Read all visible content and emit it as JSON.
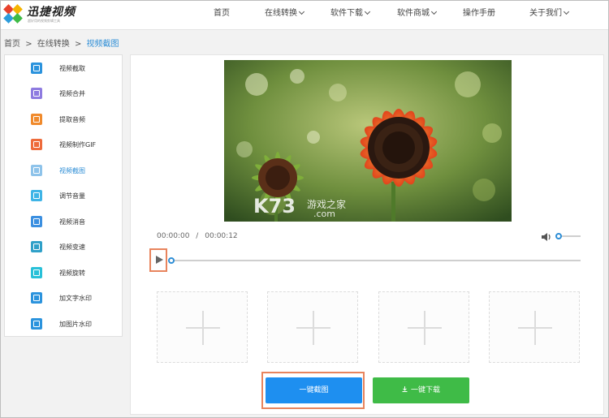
{
  "header": {
    "logo_title": "迅捷视频",
    "logo_subtitle": "超好用的视频剪辑工具",
    "nav": [
      {
        "label": "首页",
        "has_dropdown": false
      },
      {
        "label": "在线转换",
        "has_dropdown": true
      },
      {
        "label": "软件下载",
        "has_dropdown": true
      },
      {
        "label": "软件商城",
        "has_dropdown": true
      },
      {
        "label": "操作手册",
        "has_dropdown": false
      },
      {
        "label": "关于我们",
        "has_dropdown": true
      }
    ]
  },
  "breadcrumb": {
    "items": [
      "首页",
      "在线转换",
      "视频截图"
    ],
    "separator": ">"
  },
  "sidebar": {
    "items": [
      {
        "label": "视频截取",
        "icon": "crop-icon",
        "active": false
      },
      {
        "label": "视频合并",
        "icon": "merge-icon",
        "active": false
      },
      {
        "label": "提取音频",
        "icon": "headphones-icon",
        "active": false
      },
      {
        "label": "视频制作GIF",
        "icon": "gif-icon",
        "active": false
      },
      {
        "label": "视频截图",
        "icon": "scissors-icon",
        "active": true
      },
      {
        "label": "调节音量",
        "icon": "volume-icon",
        "active": false
      },
      {
        "label": "视频消音",
        "icon": "mute-video-icon",
        "active": false
      },
      {
        "label": "视频变速",
        "icon": "speed-icon",
        "active": false
      },
      {
        "label": "视频旋转",
        "icon": "rotate-icon",
        "active": false
      },
      {
        "label": "加文字水印",
        "icon": "text-watermark-icon",
        "active": false
      },
      {
        "label": "加图片水印",
        "icon": "image-watermark-icon",
        "active": false
      }
    ]
  },
  "player": {
    "current_time": "00:00:00",
    "total_time": "00:00:12",
    "time_separator": "/",
    "progress": 0,
    "volume": 0.1,
    "watermark_text": "K73",
    "watermark_sub": "游戏之家",
    "watermark_domain": ".com"
  },
  "thumbnails": {
    "count": 4
  },
  "actions": {
    "capture_label": "一键截图",
    "download_label": "一键下载"
  },
  "colors": {
    "accent": "#2e8ed6",
    "capture_button": "#1e8ff0",
    "download_button": "#3fbb47",
    "highlight_outline": "#e8845d"
  }
}
